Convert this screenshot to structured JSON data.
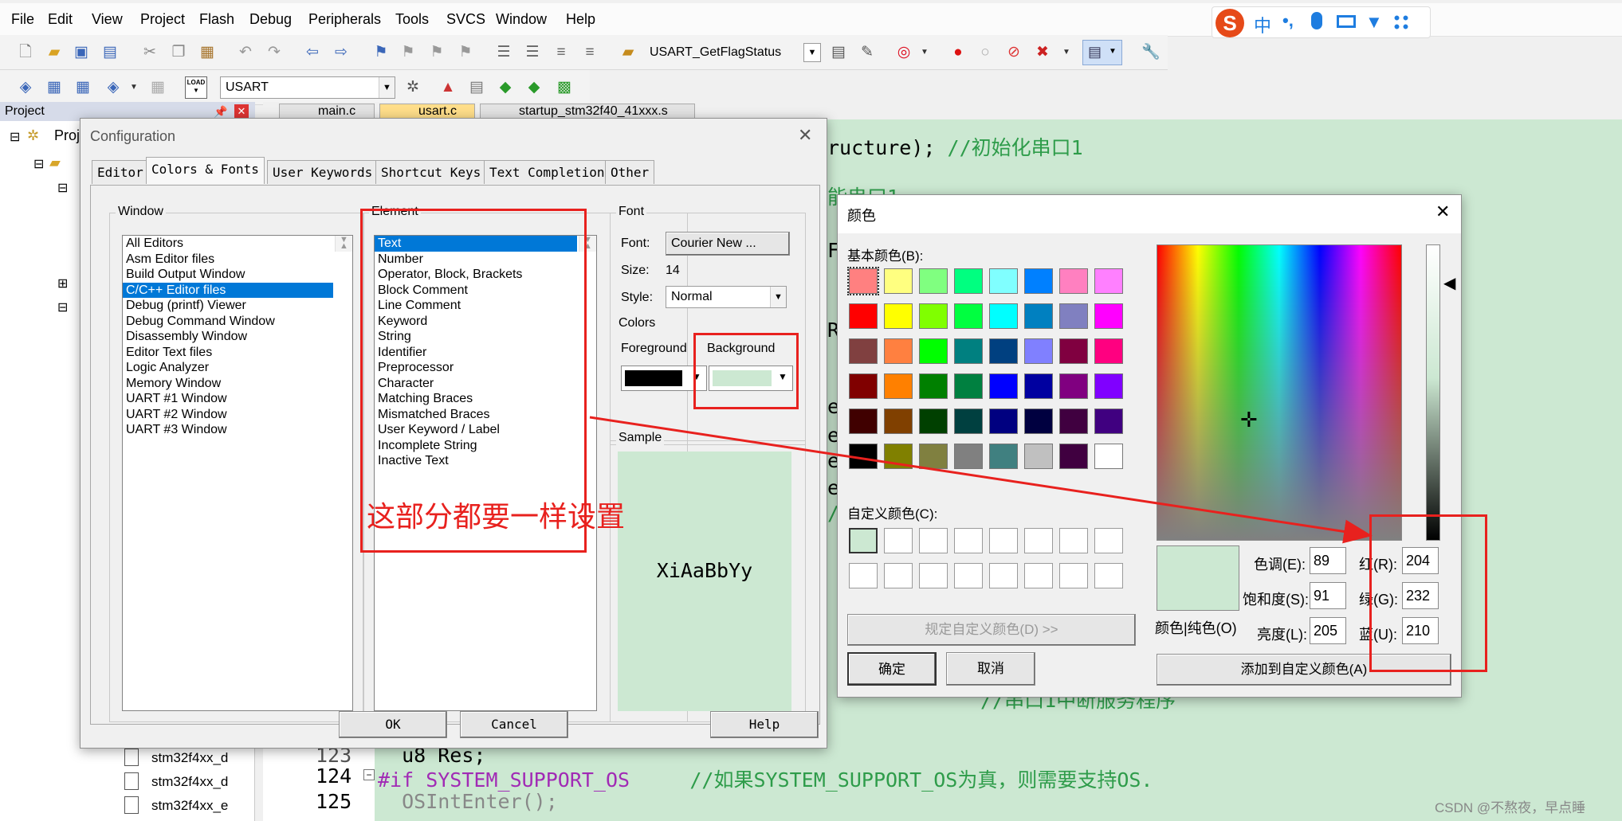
{
  "menu": [
    "File",
    "Edit",
    "View",
    "Project",
    "Flash",
    "Debug",
    "Peripherals",
    "Tools",
    "SVCS",
    "Window",
    "Help"
  ],
  "toolbar1": {
    "function_combo": "USART_GetFlagStatus"
  },
  "toolbar2": {
    "target_combo": "USART",
    "load_label": "LOAD"
  },
  "ime_bar": {
    "logo": "S",
    "lang": "中",
    "punct": "•,"
  },
  "project_pane": {
    "title": "Project",
    "root_label": "Proj",
    "files": [
      "stm32f4xx_d",
      "stm32f4xx_d",
      "stm32f4xx_e"
    ]
  },
  "editor": {
    "tabs": [
      "main.c",
      "usart.c",
      "startup_stm32f40_41xxx.s"
    ],
    "partial_lines": [
      {
        "code": "ructure); ",
        "comment": "//初始化串口1"
      },
      {
        "code": "",
        "comment": "能串口1"
      },
      {
        "code": "F",
        "comment": ""
      },
      {
        "code": "R",
        "comment": ""
      },
      {
        "code": "e",
        "comment": ""
      },
      {
        "code": "e",
        "comment": ""
      },
      {
        "code": "e",
        "comment": ""
      },
      {
        "code": "e",
        "comment": ""
      },
      {
        "code": "/",
        "comment": ""
      }
    ],
    "behind_comment": "//串口1中断服务程序",
    "lines": [
      {
        "num": "123",
        "code": "  u8 Res;",
        "comment": ""
      },
      {
        "num": "124",
        "code": "#if SYSTEM_SUPPORT_OS     ",
        "comment": "//如果SYSTEM_SUPPORT_OS为真，则需要支持OS."
      },
      {
        "num": "125",
        "code": "  OSIntEnter();",
        "comment": ""
      }
    ]
  },
  "config_dialog": {
    "title": "Configuration",
    "tabs": [
      "Editor",
      "Colors & Fonts",
      "User Keywords",
      "Shortcut Keys",
      "Text Completion",
      "Other"
    ],
    "active_tab": "Colors & Fonts",
    "window_group": {
      "label": "Window",
      "items": [
        "All Editors",
        "Asm Editor files",
        "Build Output Window",
        "C/C++ Editor files",
        "Debug (printf) Viewer",
        "Debug Command Window",
        "Disassembly Window",
        "Editor Text files",
        "Logic Analyzer",
        "Memory Window",
        "UART #1 Window",
        "UART #2 Window",
        "UART #3 Window"
      ],
      "selected": "C/C++ Editor files"
    },
    "element_group": {
      "label": "Element",
      "items": [
        "Text",
        "Number",
        "Operator, Block, Brackets",
        "Block Comment",
        "Line Comment",
        "Keyword",
        "String",
        "Identifier",
        "Preprocessor",
        "Character",
        "Matching Braces",
        "Mismatched Braces",
        "User Keyword / Label",
        "Incomplete String",
        "Inactive Text"
      ],
      "selected": "Text"
    },
    "font_group": {
      "label": "Font",
      "font_label": "Font:",
      "font_value": "Courier New ...",
      "size_label": "Size:",
      "size_value": "14",
      "style_label": "Style:",
      "style_value": "Normal"
    },
    "colors_group": {
      "label": "Colors",
      "foreground_label": "Foreground",
      "background_label": "Background",
      "foreground_color": "#000000",
      "background_color": "#cce8d2"
    },
    "sample_group": {
      "label": "Sample",
      "text": "XiAaBbYy"
    },
    "buttons": {
      "ok": "OK",
      "cancel": "Cancel",
      "help": "Help"
    }
  },
  "annotation": {
    "text": "这部分都要一样设置",
    "color": "#e8211e"
  },
  "color_dialog": {
    "title": "颜色",
    "basic_label": "基本颜色(B):",
    "custom_label": "自定义颜色(C):",
    "basic_colors": [
      [
        "#ff8080",
        "#ffff80",
        "#80ff80",
        "#00ff80",
        "#80ffff",
        "#0080ff",
        "#ff80c0",
        "#ff80ff"
      ],
      [
        "#ff0000",
        "#ffff00",
        "#80ff00",
        "#00ff40",
        "#00ffff",
        "#0080c0",
        "#8080c0",
        "#ff00ff"
      ],
      [
        "#804040",
        "#ff8040",
        "#00ff00",
        "#008080",
        "#004080",
        "#8080ff",
        "#800040",
        "#ff0080"
      ],
      [
        "#800000",
        "#ff8000",
        "#008000",
        "#008040",
        "#0000ff",
        "#0000a0",
        "#800080",
        "#8000ff"
      ],
      [
        "#400000",
        "#804000",
        "#004000",
        "#004040",
        "#000080",
        "#000040",
        "#400040",
        "#400080"
      ],
      [
        "#000000",
        "#808000",
        "#808040",
        "#808080",
        "#408080",
        "#c0c0c0",
        "#400040",
        "#ffffff"
      ]
    ],
    "custom_colors": [
      "#cce8d2",
      "#ffffff",
      "#ffffff",
      "#ffffff",
      "#ffffff",
      "#ffffff",
      "#ffffff",
      "#ffffff",
      "#ffffff",
      "#ffffff",
      "#ffffff",
      "#ffffff",
      "#ffffff",
      "#ffffff",
      "#ffffff",
      "#ffffff"
    ],
    "define_custom_button": "规定自定义颜色(D) >>",
    "solid_label": "颜色|纯色(O)",
    "hue_label": "色调(E):",
    "hue_value": "89",
    "sat_label": "饱和度(S):",
    "sat_value": "91",
    "lum_label": "亮度(L):",
    "lum_value": "205",
    "red_label": "红(R):",
    "red_value": "204",
    "green_label": "绿(G):",
    "green_value": "232",
    "blue_label": "蓝(U):",
    "blue_value": "210",
    "ok_button": "确定",
    "cancel_button": "取消",
    "add_custom_button": "添加到自定义颜色(A)"
  },
  "watermark": "CSDN @不熬夜，早点睡"
}
